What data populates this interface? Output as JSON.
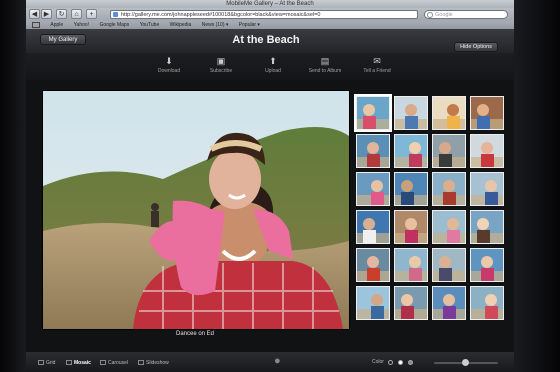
{
  "browser": {
    "window_title": "MobileMe Gallery – At the Beach",
    "url": "http://gallery.me.com/johnappleseed#100018&bgcolor=black&view=mosaic&sel=0",
    "search_placeholder": "Google",
    "bookmarks": [
      "Apple",
      "Yahoo!",
      "Google Maps",
      "YouTube",
      "Wikipedia",
      "News (10) ▾",
      "Popular ▾"
    ]
  },
  "gallery": {
    "my_gallery_label": "My Gallery",
    "album_title": "At the Beach",
    "hide_options_label": "Hide Options",
    "actions": [
      {
        "label": "Download",
        "icon": "download-icon"
      },
      {
        "label": "Subscribe",
        "icon": "subscribe-icon"
      },
      {
        "label": "Upload",
        "icon": "upload-icon"
      },
      {
        "label": "Send to Album",
        "icon": "send-icon"
      },
      {
        "label": "Tell a Friend",
        "icon": "mail-icon"
      }
    ],
    "main_photo_caption": "Dancee on Ed",
    "thumbnail_count": 24
  },
  "bottom_bar": {
    "views": [
      {
        "label": "Grid",
        "active": false
      },
      {
        "label": "Mosaic",
        "active": true
      },
      {
        "label": "Carousel",
        "active": false
      },
      {
        "label": "Slideshow",
        "active": false
      }
    ],
    "zoom_label": "Color"
  },
  "colors": {
    "background": "#111214",
    "header": "#2e3035",
    "accent": "#ffffff"
  }
}
